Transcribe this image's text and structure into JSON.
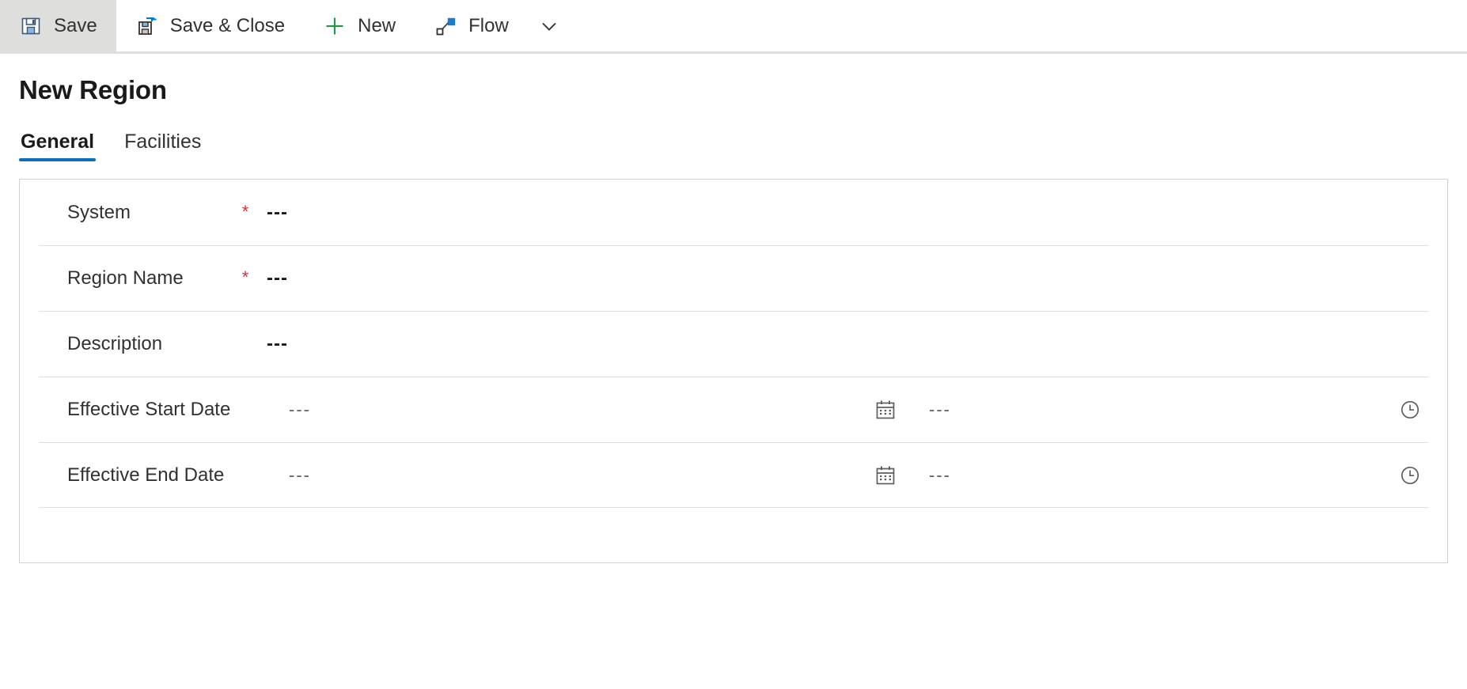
{
  "commandbar": {
    "buttons": [
      {
        "id": "save",
        "label": "Save",
        "icon": "save-floppy-icon",
        "active": true
      },
      {
        "id": "save-close",
        "label": "Save & Close",
        "icon": "save-and-close-icon",
        "active": false
      },
      {
        "id": "new",
        "label": "New",
        "icon": "plus-icon",
        "active": false
      },
      {
        "id": "flow",
        "label": "Flow",
        "icon": "flow-icon",
        "active": false
      }
    ],
    "overflow_icon": "chevron-down-icon"
  },
  "page": {
    "title": "New Region"
  },
  "tabs": [
    {
      "id": "general",
      "label": "General",
      "selected": true
    },
    {
      "id": "facilities",
      "label": "Facilities",
      "selected": false
    }
  ],
  "form": {
    "rows": [
      {
        "id": "system",
        "label": "System",
        "required": true,
        "required_marker": "*",
        "value": "---",
        "type": "lookup"
      },
      {
        "id": "region-name",
        "label": "Region Name",
        "required": true,
        "required_marker": "*",
        "value": "---",
        "type": "text"
      },
      {
        "id": "description",
        "label": "Description",
        "required": false,
        "required_marker": "",
        "value": "---",
        "type": "text"
      },
      {
        "id": "effective-start-date",
        "label": "Effective Start Date",
        "required": false,
        "required_marker": "",
        "value": "---",
        "time_value": "---",
        "type": "datetime",
        "date_icon": "calendar-icon",
        "time_icon": "clock-icon"
      },
      {
        "id": "effective-end-date",
        "label": "Effective End Date",
        "required": false,
        "required_marker": "",
        "value": "---",
        "time_value": "---",
        "type": "datetime",
        "date_icon": "calendar-icon",
        "time_icon": "clock-icon"
      }
    ]
  },
  "colors": {
    "accent": "#0f6cbd",
    "required": "#d13438",
    "icon_blue": "#0078d4",
    "icon_green": "#2b9348",
    "divider": "#e1dfdd",
    "card_border": "#d2d0ce",
    "active_button_bg": "#dededd"
  }
}
